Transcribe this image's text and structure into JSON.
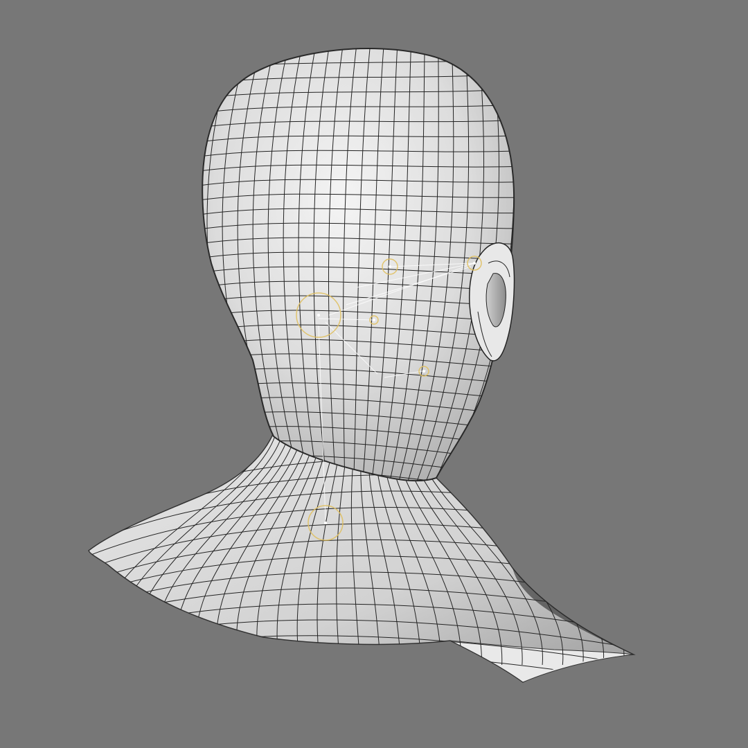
{
  "viewport": {
    "background": "#777777",
    "surface_color": "#d9d9d9",
    "wire_color": "#222222",
    "rig_color": "#ffffff",
    "rig_accent": "#e0c060"
  },
  "model": {
    "subject": "head-and-shoulders-bust",
    "view": "back-three-quarter",
    "display": "wireframe-on-shaded"
  },
  "rig": {
    "helpers": [
      "joint-helper",
      "joint-helper",
      "joint-helper",
      "joint-helper",
      "joint-helper",
      "joint-helper"
    ]
  }
}
